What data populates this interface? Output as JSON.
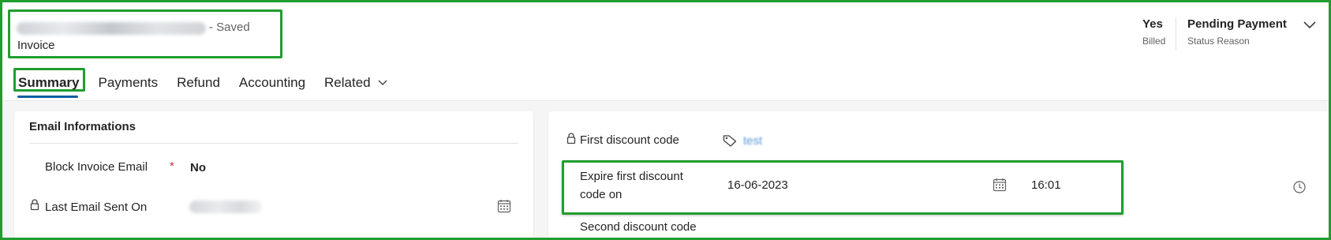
{
  "header": {
    "record_status": "- Saved",
    "entity_type": "Invoice",
    "billed": {
      "value": "Yes",
      "label": "Billed"
    },
    "status_reason": {
      "value": "Pending Payment",
      "label": "Status Reason"
    }
  },
  "tabs": [
    {
      "label": "Summary",
      "active": true
    },
    {
      "label": "Payments",
      "active": false
    },
    {
      "label": "Refund",
      "active": false
    },
    {
      "label": "Accounting",
      "active": false
    },
    {
      "label": "Related",
      "active": false
    }
  ],
  "email_section": {
    "title": "Email Informations",
    "block_invoice_email": {
      "label": "Block Invoice Email",
      "required_marker": "*",
      "value": "No"
    },
    "last_email_sent_on": {
      "label": "Last Email Sent On"
    }
  },
  "discount_section": {
    "first_discount_code": {
      "label": "First discount code",
      "value": "test"
    },
    "expire_first_discount": {
      "label_line1": "Expire first discount",
      "label_line2": "code on",
      "date": "16-06-2023",
      "time": "16:01"
    },
    "second_discount_code": {
      "label": "Second discount code"
    }
  },
  "colors": {
    "highlight_border": "#1f9e2f",
    "tab_underline": "#115ea3",
    "required": "#c4314b"
  }
}
